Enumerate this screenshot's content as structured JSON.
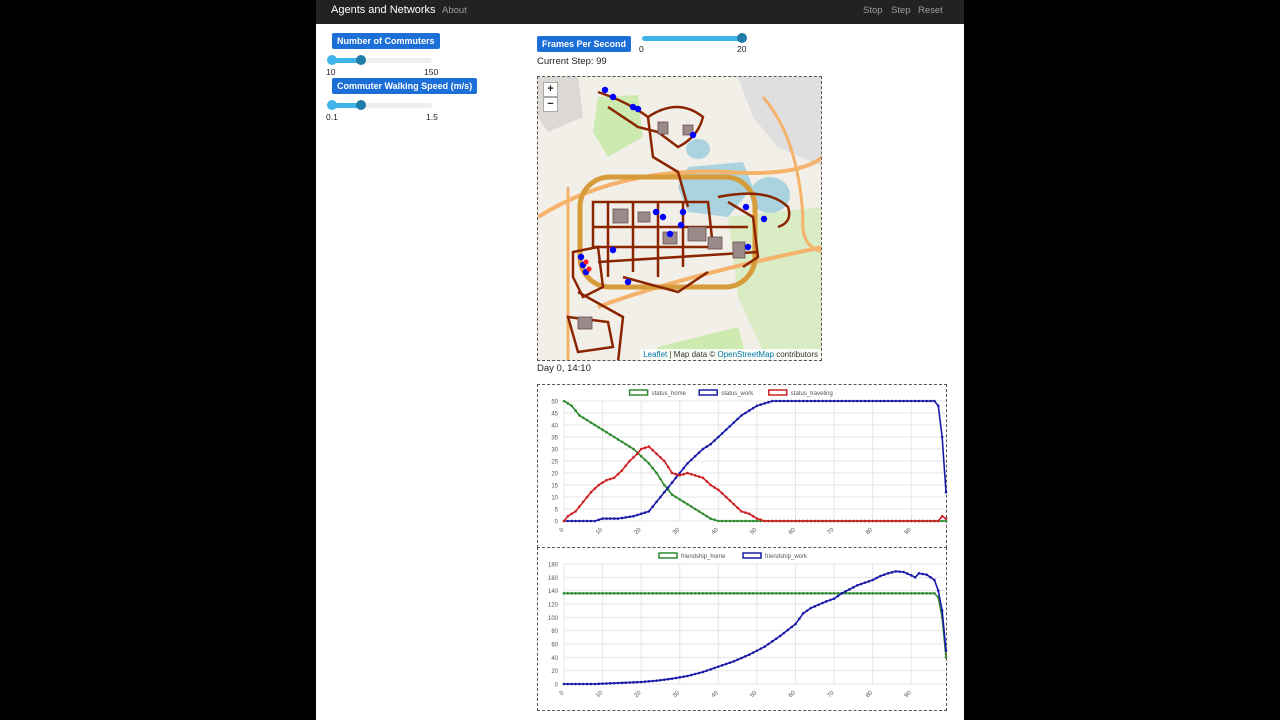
{
  "navbar": {
    "brand": "Agents and Networks",
    "about": "About",
    "stop": "Stop",
    "step": "Step",
    "reset": "Reset"
  },
  "params": {
    "commuters": {
      "label": "Number of Commuters",
      "min": "10",
      "max": "150",
      "min_value": 10,
      "max_value": 150,
      "value": 50
    },
    "speed": {
      "label": "Commuter Walking Speed (m/s)",
      "min": "0.1",
      "max": "1.5",
      "min_value": 0.1,
      "max_value": 1.5,
      "value": 0.5
    },
    "fps": {
      "label": "Frames Per Second",
      "min": "0",
      "max": "20",
      "min_value": 0,
      "max_value": 20,
      "value": 20
    }
  },
  "current_step": "Current Step: 99",
  "map": {
    "zoom_in": "+",
    "zoom_out": "−",
    "attribution_leaflet": "Leaflet",
    "attribution_mid": " | Map data © ",
    "attribution_osm": "OpenStreetMap",
    "attribution_end": " contributors",
    "colors": {
      "agent": "#0000ff",
      "road": "#8b2500",
      "water": "#aad3df",
      "park": "#cdebb0"
    }
  },
  "day_time": "Day 0, 14:10",
  "chart_data": [
    {
      "type": "line",
      "xlim": [
        0,
        99
      ],
      "ylim": [
        0,
        50
      ],
      "xticks": [
        0,
        10,
        20,
        30,
        40,
        50,
        60,
        70,
        80,
        90
      ],
      "yticks": [
        0,
        5,
        10,
        15,
        20,
        25,
        30,
        35,
        40,
        45,
        50
      ],
      "legend": "top-center",
      "grid": true,
      "series": [
        {
          "name": "status_home",
          "color": "#2e8b2e",
          "points": [
            [
              0,
              50
            ],
            [
              2,
              48
            ],
            [
              4,
              44
            ],
            [
              6,
              42
            ],
            [
              8,
              40
            ],
            [
              10,
              38
            ],
            [
              12,
              36
            ],
            [
              14,
              34
            ],
            [
              16,
              32
            ],
            [
              18,
              30
            ],
            [
              20,
              27
            ],
            [
              22,
              24
            ],
            [
              24,
              20
            ],
            [
              26,
              15
            ],
            [
              28,
              11
            ],
            [
              30,
              9
            ],
            [
              32,
              7
            ],
            [
              34,
              5
            ],
            [
              36,
              3
            ],
            [
              38,
              1
            ],
            [
              40,
              0
            ],
            [
              99,
              0
            ]
          ]
        },
        {
          "name": "status_work",
          "color": "#1a1aa8",
          "points": [
            [
              0,
              0
            ],
            [
              8,
              0
            ],
            [
              10,
              1
            ],
            [
              14,
              1
            ],
            [
              18,
              2
            ],
            [
              20,
              3
            ],
            [
              22,
              4
            ],
            [
              24,
              8
            ],
            [
              26,
              12
            ],
            [
              28,
              16
            ],
            [
              30,
              20
            ],
            [
              32,
              24
            ],
            [
              34,
              27
            ],
            [
              36,
              30
            ],
            [
              38,
              32
            ],
            [
              40,
              35
            ],
            [
              42,
              38
            ],
            [
              44,
              41
            ],
            [
              46,
              44
            ],
            [
              48,
              46
            ],
            [
              50,
              48
            ],
            [
              52,
              49
            ],
            [
              54,
              50
            ],
            [
              96,
              50
            ],
            [
              97,
              48
            ],
            [
              98,
              35
            ],
            [
              99,
              12
            ]
          ]
        },
        {
          "name": "status_traveling",
          "color": "#cc2020",
          "points": [
            [
              0,
              0
            ],
            [
              1,
              2
            ],
            [
              3,
              4
            ],
            [
              5,
              8
            ],
            [
              7,
              12
            ],
            [
              9,
              15
            ],
            [
              11,
              17
            ],
            [
              13,
              18
            ],
            [
              15,
              21
            ],
            [
              17,
              25
            ],
            [
              19,
              28
            ],
            [
              20,
              30
            ],
            [
              22,
              31
            ],
            [
              24,
              28
            ],
            [
              26,
              25
            ],
            [
              28,
              20
            ],
            [
              30,
              19
            ],
            [
              32,
              20
            ],
            [
              34,
              19
            ],
            [
              36,
              18
            ],
            [
              38,
              15
            ],
            [
              40,
              13
            ],
            [
              42,
              10
            ],
            [
              44,
              7
            ],
            [
              46,
              4
            ],
            [
              48,
              3
            ],
            [
              50,
              1
            ],
            [
              52,
              0
            ],
            [
              97,
              0
            ],
            [
              98,
              2
            ],
            [
              99,
              1
            ]
          ]
        }
      ]
    },
    {
      "type": "line",
      "xlim": [
        0,
        99
      ],
      "ylim": [
        0,
        180
      ],
      "xticks": [
        0,
        10,
        20,
        30,
        40,
        50,
        60,
        70,
        80,
        90
      ],
      "yticks": [
        0,
        20,
        40,
        60,
        80,
        100,
        120,
        140,
        160,
        180
      ],
      "legend": "top-center",
      "grid": true,
      "series": [
        {
          "name": "friendship_home",
          "color": "#2e8b2e",
          "points": [
            [
              0,
              136
            ],
            [
              96,
              136
            ],
            [
              97,
              130
            ],
            [
              98,
              100
            ],
            [
              99,
              40
            ]
          ]
        },
        {
          "name": "friendship_work",
          "color": "#1a1aa8",
          "points": [
            [
              0,
              0
            ],
            [
              8,
              0
            ],
            [
              12,
              1
            ],
            [
              16,
              2
            ],
            [
              20,
              3
            ],
            [
              24,
              5
            ],
            [
              28,
              8
            ],
            [
              32,
              12
            ],
            [
              36,
              18
            ],
            [
              40,
              26
            ],
            [
              44,
              34
            ],
            [
              48,
              44
            ],
            [
              52,
              56
            ],
            [
              56,
              72
            ],
            [
              60,
              90
            ],
            [
              62,
              106
            ],
            [
              64,
              114
            ],
            [
              66,
              119
            ],
            [
              68,
              124
            ],
            [
              70,
              128
            ],
            [
              72,
              136
            ],
            [
              74,
              142
            ],
            [
              76,
              148
            ],
            [
              78,
              152
            ],
            [
              80,
              156
            ],
            [
              82,
              162
            ],
            [
              84,
              166
            ],
            [
              86,
              169
            ],
            [
              88,
              168
            ],
            [
              90,
              163
            ],
            [
              91,
              160
            ],
            [
              92,
              166
            ],
            [
              94,
              164
            ],
            [
              96,
              156
            ],
            [
              97,
              140
            ],
            [
              98,
              110
            ],
            [
              99,
              50
            ]
          ]
        }
      ]
    }
  ]
}
